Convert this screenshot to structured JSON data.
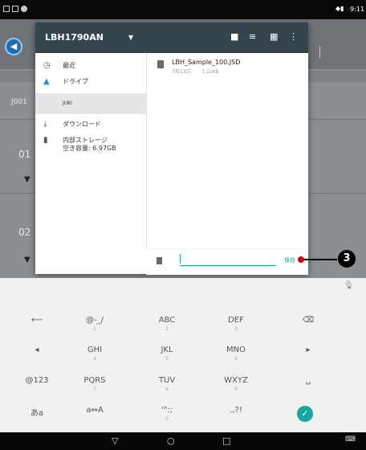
{
  "status_bar": {
    "time": "9:11"
  },
  "background": {
    "row_id": "J001",
    "rows": [
      "01",
      "02"
    ]
  },
  "dialog": {
    "title": "LBH1790AN",
    "header_icons": [
      "folder-icon",
      "sort-icon",
      "grid-view-icon",
      "more-vert-icon"
    ],
    "drawer": [
      {
        "icon": "clock-icon",
        "label": "最近"
      },
      {
        "icon": "drive-icon",
        "label": "ドライブ"
      },
      {
        "icon": "",
        "label": "JUKI",
        "selected": true
      },
      {
        "icon": "download-icon",
        "label": "ダウンロード"
      },
      {
        "icon": "sd-card-icon",
        "label": "内部ストレージ",
        "sub": "空き容量: 6.97GB"
      }
    ],
    "file": {
      "name": "LBH_Sample_100.JSD",
      "date": "7月13日",
      "size": "1.11KB"
    },
    "filename_input": {
      "value": "",
      "placeholder": ""
    },
    "save_label": "保存"
  },
  "callout": {
    "number": "3"
  },
  "keyboard": {
    "rows": [
      [
        {
          "main": "⟵",
          "sub": ""
        },
        {
          "main": "@-_/",
          "sub": "1"
        },
        {
          "main": "ABC",
          "sub": "2"
        },
        {
          "main": "DEF",
          "sub": "3"
        },
        {
          "main": "⌫",
          "sub": ""
        }
      ],
      [
        {
          "main": "◂",
          "sub": ""
        },
        {
          "main": "GHI",
          "sub": "4"
        },
        {
          "main": "JKL",
          "sub": "5"
        },
        {
          "main": "MNO",
          "sub": "6"
        },
        {
          "main": "▸",
          "sub": ""
        }
      ],
      [
        {
          "main": "@123",
          "sub": ""
        },
        {
          "main": "PQRS",
          "sub": "7"
        },
        {
          "main": "TUV",
          "sub": "8"
        },
        {
          "main": "WXYZ",
          "sub": "9"
        },
        {
          "main": "␣",
          "sub": ""
        }
      ],
      [
        {
          "main": "あa",
          "sub": ""
        },
        {
          "main": "a⇔A",
          "sub": ""
        },
        {
          "main": "'\":;",
          "sub": "0"
        },
        {
          "main": ".,?!",
          "sub": ""
        },
        {
          "main": "✓",
          "sub": ""
        }
      ]
    ]
  },
  "nav_bar": {
    "back": "▽",
    "home": "○",
    "recents": "□"
  }
}
